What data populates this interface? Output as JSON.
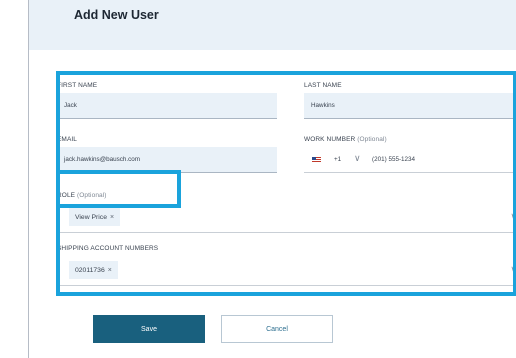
{
  "header": {
    "title": "Add New User"
  },
  "form": {
    "first_name": {
      "label": "FIRST NAME",
      "value": "Jack"
    },
    "last_name": {
      "label": "LAST NAME",
      "value": "Hawkins"
    },
    "email": {
      "label": "EMAIL",
      "value": "jack.hawkins@bausch.com"
    },
    "work_number": {
      "label": "WORK NUMBER",
      "optional": "(Optional)",
      "country_code": "+1",
      "value": "(201) 555-1234"
    },
    "role": {
      "label": "ROLE",
      "optional": "(Optional)",
      "chips": [
        {
          "label": "View Price",
          "remove": "×"
        }
      ]
    },
    "shipping": {
      "label": "SHIPPING ACCOUNT NUMBERS",
      "chips": [
        {
          "label": "02011736",
          "remove": "×"
        }
      ]
    }
  },
  "icons": {
    "chevron": "∨",
    "flag": "us-flag-icon"
  },
  "actions": {
    "save_label": "Save",
    "cancel_label": "Cancel"
  },
  "colors": {
    "highlight": "#1aa3dc",
    "primary": "#19607e",
    "field_bg": "#e9f1f8"
  }
}
